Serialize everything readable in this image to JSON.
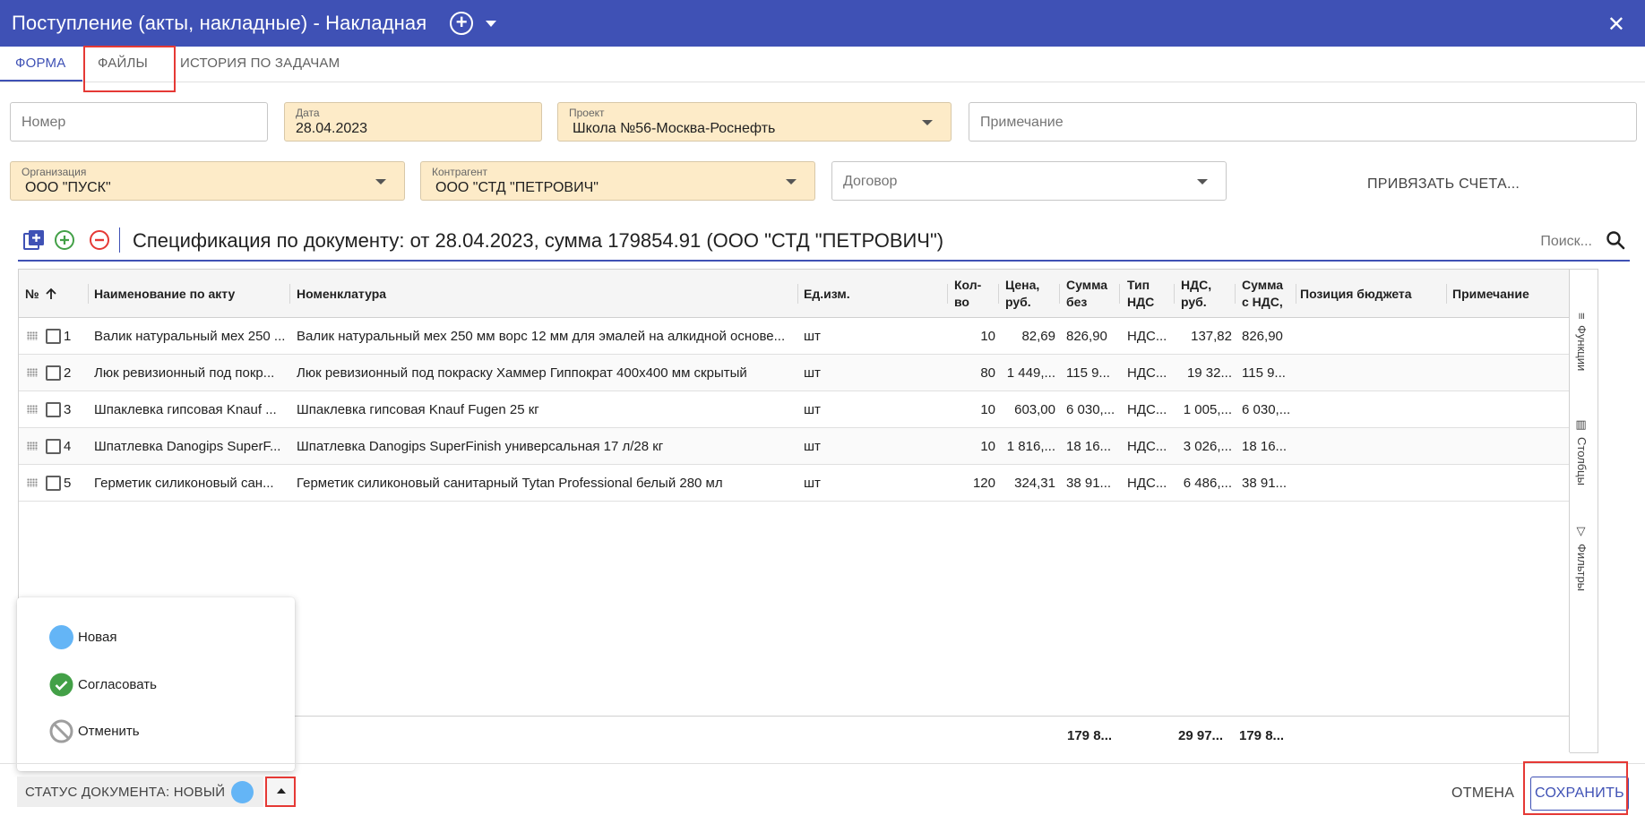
{
  "window": {
    "title": "Поступление (акты, накладные) - Накладная",
    "add_icon": "plus-circle-icon",
    "menu_icon": "caret-down-icon",
    "close_icon": "close-icon",
    "accent_color": "#3f51b5"
  },
  "tabs": [
    {
      "label": "ФОРМА",
      "active": true
    },
    {
      "label": "ФАЙЛЫ",
      "active": false
    },
    {
      "label": "ИСТОРИЯ ПО ЗАДАЧАМ",
      "active": false
    }
  ],
  "form": {
    "number": {
      "placeholder": "Номер",
      "value": ""
    },
    "date": {
      "label": "Дата",
      "value": "28.04.2023"
    },
    "project": {
      "label": "Проект",
      "value": "Школа №56-Москва-Роснефть"
    },
    "note": {
      "placeholder": "Примечание",
      "value": ""
    },
    "organization": {
      "label": "Организация",
      "value": "ООО \"ПУСК\""
    },
    "counterparty": {
      "label": "Контрагент",
      "value": "ООО \"СТД \"ПЕТРОВИЧ\""
    },
    "contract": {
      "placeholder": "Договор",
      "value": ""
    },
    "link_invoices_label": "ПРИВЯЗАТЬ СЧЕТА..."
  },
  "spec": {
    "title": "Спецификация по документу: от 28.04.2023, сумма 179854.91 (ООО \"СТД \"ПЕТРОВИЧ\")",
    "search_placeholder": "Поиск...",
    "toolbar_icons": [
      "add-copy-icon",
      "add-row-icon",
      "remove-row-icon",
      "search-icon"
    ]
  },
  "grid": {
    "columns": [
      {
        "label": "№",
        "sort": "asc"
      },
      {
        "label": "Наименование по акту"
      },
      {
        "label": "Номенклатура"
      },
      {
        "label": "Ед.изм."
      },
      {
        "label": "Кол-во",
        "line1": "Кол-",
        "line2": "во"
      },
      {
        "label": "Цена, руб.",
        "line1": "Цена,",
        "line2": "руб."
      },
      {
        "label": "Сумма без",
        "line1": "Сумма",
        "line2": "без"
      },
      {
        "label": "Тип НДС",
        "line1": "Тип",
        "line2": "НДС"
      },
      {
        "label": "НДС, руб.",
        "line1": "НДС,",
        "line2": "руб."
      },
      {
        "label": "Сумма с НДС,",
        "line1": "Сумма",
        "line2": "с НДС,"
      },
      {
        "label": "Позиция бюджета"
      },
      {
        "label": "Примечание"
      }
    ],
    "rows": [
      {
        "n": "1",
        "act_name": "Валик натуральный мех 250 ...",
        "nomenclature": "Валик натуральный мех 250 мм ворс 12 мм для эмалей на алкидной основе...",
        "unit": "шт",
        "qty": "10",
        "price": "82,69",
        "sum_wo": "826,90",
        "vat_type": "НДС...",
        "vat": "137,82",
        "sum_with": "826,90",
        "budget": "",
        "note": ""
      },
      {
        "n": "2",
        "act_name": "Люк ревизионный под покр...",
        "nomenclature": "Люк ревизионный под покраску Хаммер Гиппократ 400х400 мм скрытый",
        "unit": "шт",
        "qty": "80",
        "price": "1 449,...",
        "sum_wo": "115 9...",
        "vat_type": "НДС...",
        "vat": "19 32...",
        "sum_with": "115 9...",
        "budget": "",
        "note": ""
      },
      {
        "n": "3",
        "act_name": "Шпаклевка гипсовая Knauf ...",
        "nomenclature": "Шпаклевка гипсовая Knauf Fugen 25 кг",
        "unit": "шт",
        "qty": "10",
        "price": "603,00",
        "sum_wo": "6 030,...",
        "vat_type": "НДС...",
        "vat": "1 005,...",
        "sum_with": "6 030,...",
        "budget": "",
        "note": ""
      },
      {
        "n": "4",
        "act_name": "Шпатлевка Danogips SuperF...",
        "nomenclature": "Шпатлевка Danogips SuperFinish универсальная 17 л/28 кг",
        "unit": "шт",
        "qty": "10",
        "price": "1 816,...",
        "sum_wo": "18 16...",
        "vat_type": "НДС...",
        "vat": "3 026,...",
        "sum_with": "18 16...",
        "budget": "",
        "note": ""
      },
      {
        "n": "5",
        "act_name": "Герметик силиконовый сан...",
        "nomenclature": "Герметик силиконовый санитарный Tytan Professional белый 280 мл",
        "unit": "шт",
        "qty": "120",
        "price": "324,31",
        "sum_wo": "38 91...",
        "vat_type": "НДС...",
        "vat": "6 486,...",
        "sum_with": "38 91...",
        "budget": "",
        "note": ""
      }
    ],
    "totals": {
      "sum_wo": "179 8...",
      "vat": "29 97...",
      "sum_with": "179 8..."
    },
    "side_panel": [
      {
        "label": "Функции",
        "icon": "menu-icon"
      },
      {
        "label": "Столбцы",
        "icon": "columns-icon"
      },
      {
        "label": "Фильтры",
        "icon": "filter-icon"
      }
    ]
  },
  "status_menu": [
    {
      "label": "Новая",
      "icon": "circle-icon",
      "color": "#64b5f6"
    },
    {
      "label": "Согласовать",
      "icon": "check-circle-icon",
      "color": "#43a047"
    },
    {
      "label": "Отменить",
      "icon": "block-icon",
      "color": "#9e9e9e"
    }
  ],
  "bottom": {
    "status_label": "СТАТУС ДОКУМЕНТА: НОВЫЙ",
    "status_color": "#64b5f6",
    "cancel_label": "ОТМЕНА",
    "save_label": "СОХРАНИТЬ"
  }
}
